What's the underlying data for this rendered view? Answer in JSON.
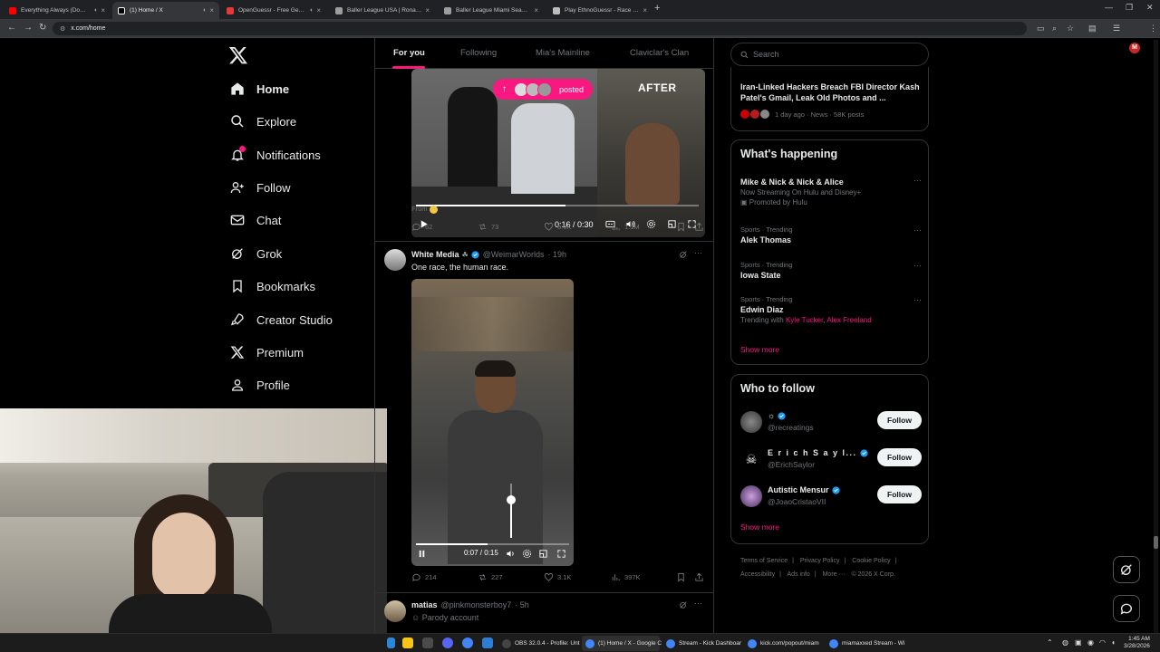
{
  "browser": {
    "tabs": [
      {
        "label": "Everything Always (Dom D...",
        "favicon_color": "#ff0000",
        "audio": true
      },
      {
        "label": "(1) Home / X",
        "favicon_color": "#ffffff",
        "audio": true,
        "active": true
      },
      {
        "label": "OpenGuessr - Free GeoGue...",
        "favicon_color": "#e53935",
        "audio": true
      },
      {
        "label": "Baller League USA | Ronaldinho...",
        "favicon_color": "#9e9e9e",
        "audio": false
      },
      {
        "label": "Baller League Miami Season 1 ...",
        "favicon_color": "#9e9e9e",
        "audio": false
      },
      {
        "label": "Play EthnoGuessr - Race Guessr...",
        "favicon_color": "#bdbdbd",
        "audio": false
      }
    ],
    "url": "x.com/home",
    "profile_initial": "M"
  },
  "nav": {
    "items": [
      {
        "label": "Home",
        "icon": "home-icon"
      },
      {
        "label": "Explore",
        "icon": "search-icon"
      },
      {
        "label": "Notifications",
        "icon": "bell-icon"
      },
      {
        "label": "Follow",
        "icon": "add-user-icon"
      },
      {
        "label": "Chat",
        "icon": "mail-icon"
      },
      {
        "label": "Grok",
        "icon": "grok-icon"
      },
      {
        "label": "Bookmarks",
        "icon": "bookmark-icon"
      },
      {
        "label": "Creator Studio",
        "icon": "rocket-icon"
      },
      {
        "label": "Premium",
        "icon": "x-logo-icon"
      },
      {
        "label": "Profile",
        "icon": "person-icon"
      }
    ],
    "notifications_badge": "1"
  },
  "feed": {
    "tabs": [
      "For you",
      "Following",
      "Mia's Mainline",
      "Claviclar's Clan"
    ],
    "active_tab": "For you",
    "post1": {
      "posted_label": "posted",
      "after_label": "AFTER",
      "time": "0:16 / 0:30",
      "progress": 0.53,
      "from_label": "From",
      "replies": "62",
      "reposts": "73",
      "likes": "6.6K",
      "views": "1.1M"
    },
    "post2": {
      "name": "White Media",
      "handle": "@WeimarWorlds",
      "age": "· 19h",
      "text": "One race, the human race.",
      "time": "0:07 / 0:15",
      "progress": 0.47,
      "volume": 0.7,
      "replies": "214",
      "reposts": "227",
      "likes": "3.1K",
      "views": "397K"
    },
    "post3": {
      "name": "matias",
      "handle": "@pinkmonsterboy7",
      "age": "· 5h",
      "subtext": "Parody account"
    }
  },
  "right": {
    "search_placeholder": "Search",
    "news": {
      "title": "Iran-Linked Hackers Breach FBI Director Kash Patel's Gmail, Leak Old Photos and ...",
      "meta": "1 day ago · News · 58K posts"
    },
    "happening_title": "What's happening",
    "trends": [
      {
        "context": "",
        "name": "Mike & Nick & Nick & Alice",
        "sub": "Now Streaming On Hulu and Disney+",
        "promo": "Promoted by Hulu"
      },
      {
        "context": "Sports · Trending",
        "name": "Alek Thomas"
      },
      {
        "context": "Sports · Trending",
        "name": "Iowa State"
      },
      {
        "context": "Sports · Trending",
        "name": "Edwin Diaz",
        "trending_with": "Trending with",
        "names": [
          "Kyle Tucker",
          "Alex Freeland"
        ]
      }
    ],
    "show_more": "Show more",
    "who_to_follow_title": "Who to follow",
    "who_to_follow": [
      {
        "name": "☼",
        "handle": "@recreatings",
        "verified": true,
        "follow": "Follow"
      },
      {
        "name": "E r i c h  S a y l...",
        "handle": "@ErichSaylor",
        "verified": true,
        "follow": "Follow"
      },
      {
        "name": "Autistic Mensur",
        "handle": "@JoaoCristaoVII",
        "verified": true,
        "follow": "Follow"
      }
    ],
    "show_more2": "Show more",
    "footer": [
      "Terms of Service",
      "|",
      "Privacy Policy",
      "|",
      "Cookie Policy",
      "|",
      "Accessibility",
      "|",
      "Ads info",
      "|",
      "More ···",
      "© 2026 X Corp."
    ]
  },
  "taskbar": {
    "tasks": [
      {
        "label": "OBS 32.0.4 - Profile: Unt",
        "color": "#444444"
      },
      {
        "label": "(1) Home / X - Google C",
        "color": "#4285f4",
        "active": true
      },
      {
        "label": "Stream - Kick Dashboar",
        "color": "#4285f4"
      },
      {
        "label": "kick.com/popout/miam",
        "color": "#4285f4"
      },
      {
        "label": "miamaxxed Stream - Wi",
        "color": "#4285f4"
      }
    ],
    "time": "1:45 AM",
    "date": "3/28/2026"
  },
  "colors": {
    "accent": "#f91880",
    "verified": "#1d9bf0",
    "bg": "#000000",
    "border": "#2f3336"
  }
}
